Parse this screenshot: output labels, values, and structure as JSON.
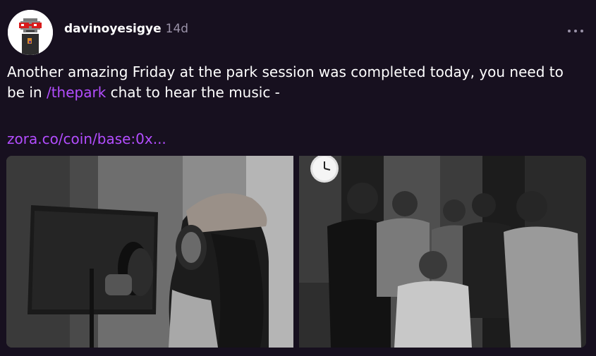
{
  "post": {
    "username": "davinoyesigye",
    "timestamp": "14d",
    "more_icon": "ellipsis-icon",
    "text_part1": "Another amazing Friday at the park session was completed today, you need to be in ",
    "mention": "/thepark",
    "text_part2": " chat to hear the music -",
    "link": "zora.co/coin/base:0x...",
    "images": [
      {
        "name": "studio-vocalist-photo"
      },
      {
        "name": "studio-group-photo"
      }
    ]
  },
  "colors": {
    "background": "#17101f",
    "accent": "#b34dff",
    "muted": "#9a92a8"
  }
}
